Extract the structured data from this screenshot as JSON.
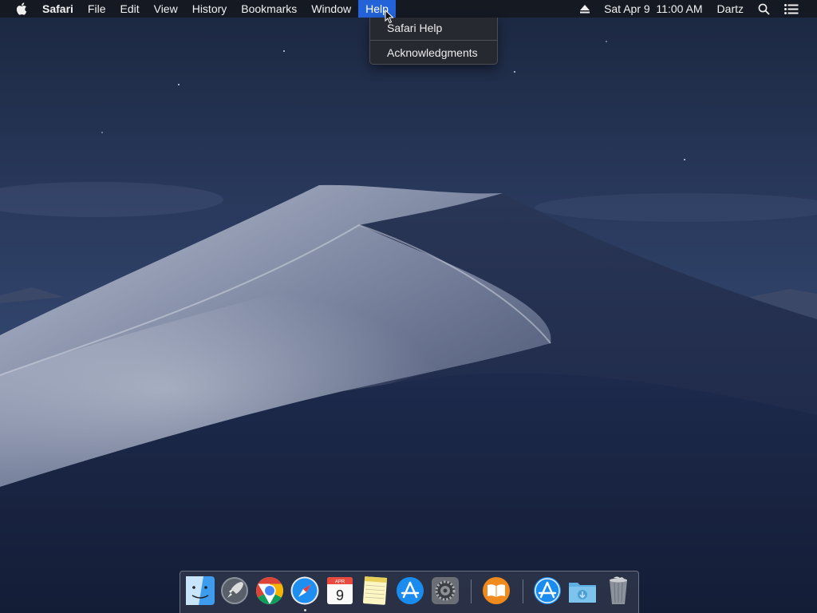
{
  "menubar": {
    "apple_icon": "apple-logo-icon",
    "items": [
      {
        "label": "Safari",
        "bold": true
      },
      {
        "label": "File"
      },
      {
        "label": "Edit"
      },
      {
        "label": "View"
      },
      {
        "label": "History"
      },
      {
        "label": "Bookmarks"
      },
      {
        "label": "Window"
      },
      {
        "label": "Help",
        "active": true
      }
    ],
    "status": {
      "eject_icon": "eject-icon",
      "date_time": "Sat Apr 9  11:00 AM",
      "user": "Dartz",
      "spotlight_icon": "spotlight-search-icon",
      "notification_icon": "notification-center-icon"
    }
  },
  "help_menu": {
    "items": [
      "Safari Help",
      "Acknowledgments"
    ]
  },
  "dock": {
    "apps": [
      {
        "name": "Finder",
        "icon": "finder-icon"
      },
      {
        "name": "Launchpad",
        "icon": "launchpad-icon"
      },
      {
        "name": "Google Chrome",
        "icon": "chrome-icon"
      },
      {
        "name": "Safari",
        "icon": "safari-icon",
        "running": true
      },
      {
        "name": "Calendar",
        "icon": "calendar-icon",
        "month": "APR",
        "day": "9"
      },
      {
        "name": "Notes",
        "icon": "notes-icon"
      },
      {
        "name": "App Store",
        "icon": "app-store-icon"
      },
      {
        "name": "System Preferences",
        "icon": "system-preferences-icon"
      },
      {
        "name": "Books",
        "icon": "books-icon"
      },
      {
        "name": "Applications",
        "icon": "applications-stack-icon"
      },
      {
        "name": "Downloads",
        "icon": "downloads-folder-icon"
      },
      {
        "name": "Trash",
        "icon": "trash-icon"
      }
    ]
  },
  "colors": {
    "menu_highlight": "#2363d9",
    "sky_top": "#1b2740",
    "dune_light": "#9aa3b8"
  }
}
